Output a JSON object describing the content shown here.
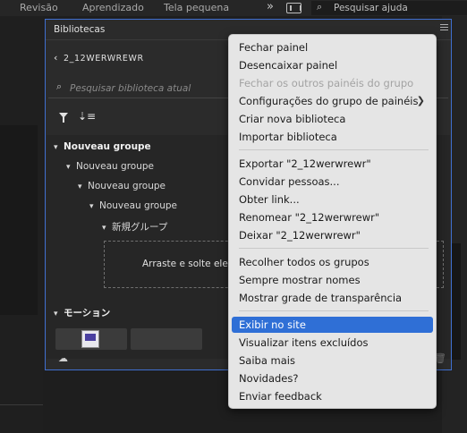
{
  "topbar": {
    "items": [
      "Revisão",
      "Aprendizado",
      "Tela pequena"
    ],
    "more_glyph": "»",
    "search_text": "Pesquisar ajuda"
  },
  "panel": {
    "title": "Bibliotecas",
    "library_name": "2_12WERWREWR",
    "search_placeholder": "Pesquisar biblioteca atual",
    "tree": [
      {
        "label": "Nouveau groupe",
        "bold": true
      },
      {
        "label": "Nouveau groupe"
      },
      {
        "label": "Nouveau groupe"
      },
      {
        "label": "Nouveau groupe"
      },
      {
        "label": "新規グループ"
      }
    ],
    "drop_text": "Arraste e solte eleme",
    "section2": "モーション"
  },
  "menu": {
    "items": [
      {
        "label": "Fechar painel"
      },
      {
        "label": "Desencaixar painel"
      },
      {
        "label": "Fechar os outros painéis do grupo",
        "disabled": true
      },
      {
        "label": "Configurações do grupo de painéis",
        "submenu": true
      },
      {
        "label": "Criar nova biblioteca"
      },
      {
        "label": "Importar biblioteca"
      },
      {
        "label": "Exportar \"2_12werwrewr\""
      },
      {
        "label": "Convidar pessoas..."
      },
      {
        "label": "Obter link..."
      },
      {
        "label": "Renomear \"2_12werwrewr\""
      },
      {
        "label": "Deixar \"2_12werwrewr\""
      },
      {
        "label": "Recolher todos os grupos"
      },
      {
        "label": "Sempre mostrar nomes"
      },
      {
        "label": "Mostrar grade de transparência"
      },
      {
        "label": "Exibir no site",
        "active": true
      },
      {
        "label": "Visualizar itens excluídos"
      },
      {
        "label": "Saiba mais"
      },
      {
        "label": "Novidades?"
      },
      {
        "label": "Enviar feedback"
      }
    ],
    "submenu_glyph": "❯"
  },
  "colors": {
    "accent": "#2f6fd6",
    "panel_border": "#3f6fd0",
    "menu_bg": "#e5e5e5"
  }
}
